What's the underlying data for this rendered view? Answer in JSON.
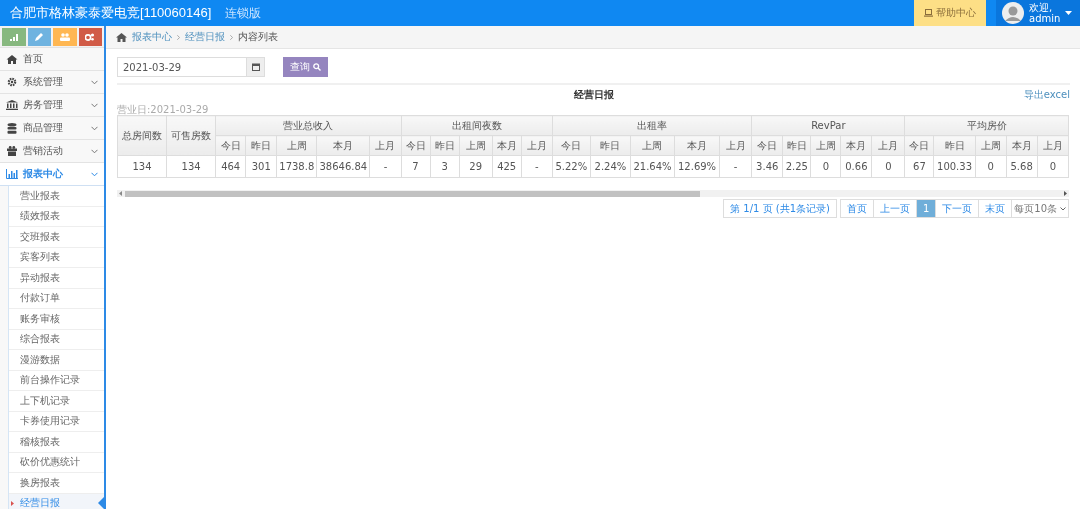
{
  "header": {
    "title": "合肥市格林豪泰爱电竞[110060146]",
    "edition": "连锁版",
    "help_button": "帮助中心",
    "greeting": "欢迎,",
    "user": "admin"
  },
  "sidebar": {
    "items": [
      {
        "label": "首页",
        "selected": false,
        "kind": "link"
      },
      {
        "label": "系统管理",
        "selected": false,
        "kind": "group"
      },
      {
        "label": "房务管理",
        "selected": false,
        "kind": "group"
      },
      {
        "label": "商品管理",
        "selected": false,
        "kind": "group"
      },
      {
        "label": "营销活动",
        "selected": false,
        "kind": "group"
      },
      {
        "label": "报表中心",
        "selected": true,
        "kind": "group",
        "expanded": true,
        "children": [
          {
            "label": "营业报表",
            "selected": false
          },
          {
            "label": "绩效报表",
            "selected": false
          },
          {
            "label": "交班报表",
            "selected": false
          },
          {
            "label": "宾客列表",
            "selected": false
          },
          {
            "label": "异动报表",
            "selected": false
          },
          {
            "label": "付款订单",
            "selected": false
          },
          {
            "label": "账务审核",
            "selected": false
          },
          {
            "label": "综合报表",
            "selected": false
          },
          {
            "label": "漫游数据",
            "selected": false
          },
          {
            "label": "前台操作记录",
            "selected": false
          },
          {
            "label": "上下机记录",
            "selected": false
          },
          {
            "label": "卡券使用记录",
            "selected": false
          },
          {
            "label": "稽核报表",
            "selected": false
          },
          {
            "label": "砍价优惠统计",
            "selected": false
          },
          {
            "label": "换房报表",
            "selected": false
          },
          {
            "label": "经营日报",
            "selected": true
          }
        ]
      }
    ]
  },
  "breadcrumb": [
    "报表中心",
    "经营日报",
    "内容列表"
  ],
  "filter": {
    "date": "2021-03-29",
    "query_button": "查询"
  },
  "report": {
    "title": "经营日报",
    "export_link": "导出excel",
    "business_date": "营业日:2021-03-29",
    "table": {
      "fixed_columns": [
        "总房间数",
        "可售房数"
      ],
      "groups": [
        {
          "label": "营业总收入",
          "columns": [
            "今日",
            "昨日",
            "上周",
            "本月",
            "上月"
          ]
        },
        {
          "label": "出租间夜数",
          "columns": [
            "今日",
            "昨日",
            "上周",
            "本月",
            "上月"
          ]
        },
        {
          "label": "出租率",
          "columns": [
            "今日",
            "昨日",
            "上周",
            "本月",
            "上月"
          ]
        },
        {
          "label": "RevPar",
          "columns": [
            "今日",
            "昨日",
            "上周",
            "本月",
            "上月"
          ]
        },
        {
          "label": "平均房价",
          "columns": [
            "今日",
            "昨日",
            "上周",
            "本月",
            "上月"
          ]
        }
      ],
      "rows": [
        [
          "134",
          "134",
          "464",
          "301",
          "1738.8",
          "38646.84",
          "-",
          "7",
          "3",
          "29",
          "425",
          "-",
          "5.22%",
          "2.24%",
          "21.64%",
          "12.69%",
          "-",
          "3.46",
          "2.25",
          "0",
          "0.66",
          "0",
          "67",
          "100.33",
          "0",
          "5.68",
          "0"
        ]
      ]
    }
  },
  "pagination": {
    "info": "第 1/1 页 (共1条记录)",
    "buttons": [
      {
        "label": "首页",
        "selected": false
      },
      {
        "label": "上一页",
        "selected": false
      },
      {
        "label": "1",
        "selected": true
      },
      {
        "label": "下一页",
        "selected": false
      },
      {
        "label": "末页",
        "selected": false
      }
    ],
    "page_size": "每页10条"
  }
}
